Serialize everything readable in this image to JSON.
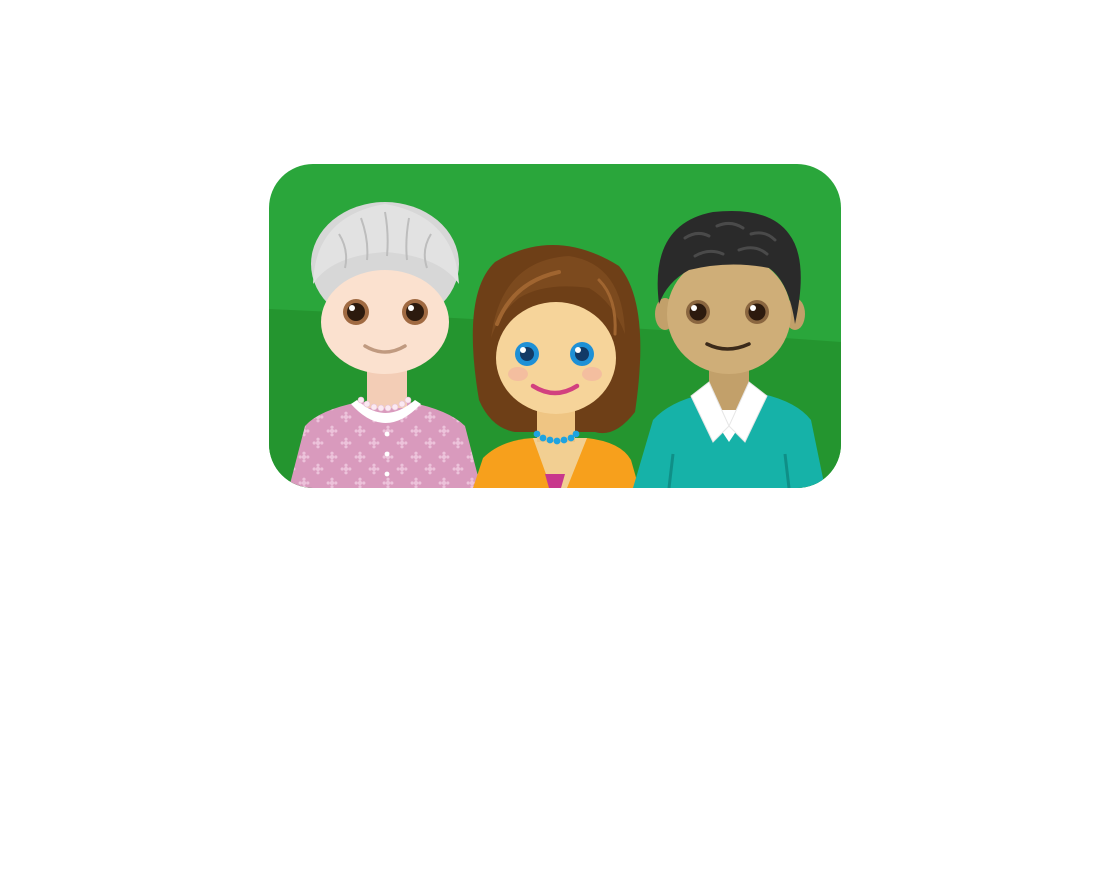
{
  "scene": {
    "kind": "illustration",
    "people": [
      {
        "id": "grandmother"
      },
      {
        "id": "woman"
      },
      {
        "id": "man"
      }
    ]
  },
  "colors": {
    "background_green": "#2aa63b",
    "background_green_dark": "#24952f",
    "grandmother_hair": "#e2e2e2",
    "grandmother_skin": "#fbe1cf",
    "grandmother_top": "#d99abd",
    "woman_hair": "#7c4a1e",
    "woman_skin": "#f6d49a",
    "woman_top": "#f7a01c",
    "woman_necklace": "#1ea3e0",
    "man_hair": "#2a2a2a",
    "man_skin": "#cfae78",
    "man_sweater": "#16b2a8",
    "man_collar": "#ffffff"
  }
}
